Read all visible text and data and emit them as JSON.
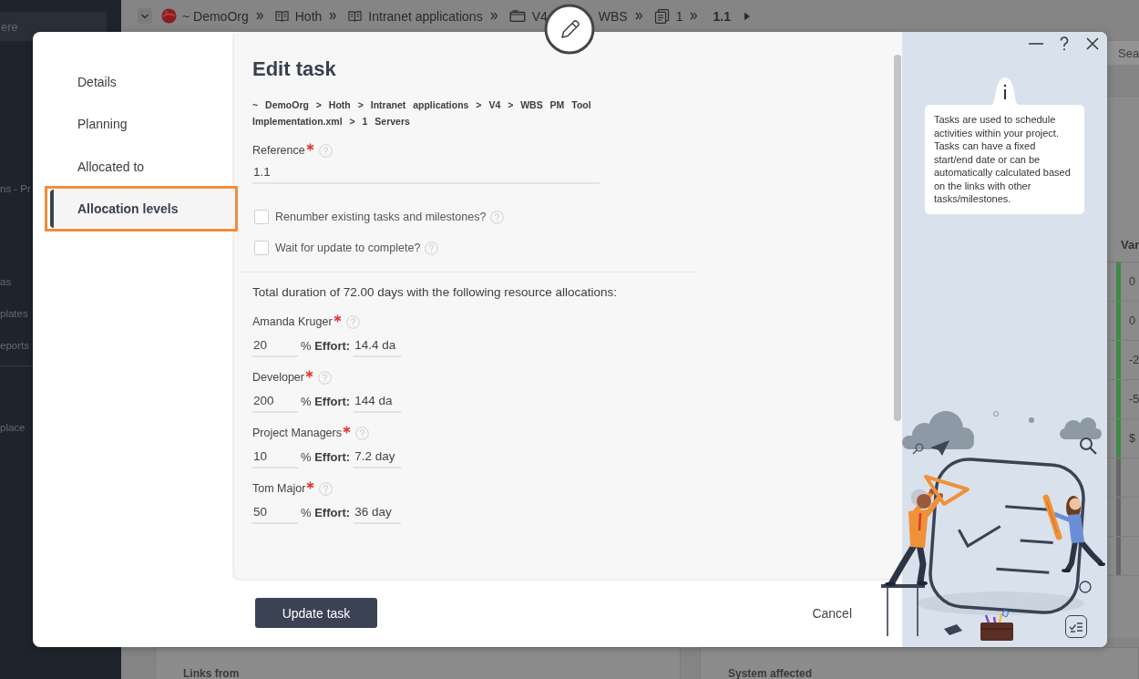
{
  "app": {
    "sidebar": {
      "search_placeholder": "ere",
      "sections": [
        {
          "items": [
            "ns - Pr"
          ]
        },
        {
          "items": [
            "as",
            "plates",
            "eports"
          ]
        },
        {
          "divider": true,
          "items": [
            "place"
          ]
        }
      ]
    },
    "breadcrumb": [
      {
        "label": "~ DemoOrg",
        "kind": "logo",
        "current": false
      },
      {
        "label": "Hoth",
        "kind": "book",
        "separator": true,
        "current": false
      },
      {
        "label": "Intranet applications",
        "kind": "book",
        "separator": true,
        "current": false
      },
      {
        "label": "V4",
        "kind": "folder",
        "separator": true,
        "current": false
      },
      {
        "label": "WBS",
        "kind": "plain",
        "separator": false,
        "current": false
      },
      {
        "label": "1",
        "kind": "document",
        "separator": true,
        "current": false
      },
      {
        "label": "1.1",
        "kind": "plain",
        "separator": true,
        "current": true
      }
    ],
    "search_placeholder": "Sea",
    "table": {
      "header": "Var",
      "cells": [
        {
          "text": "0",
          "color": "#3e8a45"
        },
        {
          "text": "0",
          "color": "#3e8a45"
        },
        {
          "text": "-2",
          "color": "#3e8a45"
        },
        {
          "text": "-5",
          "color": "#3e8a45"
        },
        {
          "text": "$",
          "color": "#3e8a45"
        },
        {
          "color": "#666666"
        },
        {
          "color": "#666666"
        },
        {
          "color": "#666666"
        }
      ]
    },
    "panels": [
      "Links from",
      "System affected"
    ]
  },
  "dialog": {
    "nav": [
      {
        "label": "Details",
        "selected": false,
        "highlighted": false
      },
      {
        "label": "Planning",
        "selected": false,
        "highlighted": false
      },
      {
        "label": "Allocated to",
        "selected": false,
        "highlighted": false
      },
      {
        "label": "Allocation levels",
        "selected": true,
        "highlighted": true
      }
    ],
    "title": "Edit task",
    "breadcrumb": "~ DemoOrg > Hoth > Intranet applications > V4 > WBS PM Tool Implementation.xml > 1 Servers",
    "reference": {
      "label": "Reference",
      "required": true,
      "value": "1.1"
    },
    "options": [
      {
        "label": "Renumber existing tasks and milestones?",
        "checked": false
      },
      {
        "label": "Wait for update to complete?",
        "checked": false
      }
    ],
    "summary": "Total duration of 72.00 days with the following resource allocations:",
    "allocations": [
      {
        "name": "Amanda Kruger",
        "required": true,
        "percent": "20",
        "unit": "% **Effort:**",
        "effort": "14.4 da"
      },
      {
        "name": "Developer",
        "required": true,
        "percent": "200",
        "unit": "% **Effort:**",
        "effort": "144 da"
      },
      {
        "name": "Project Managers",
        "required": true,
        "percent": "10",
        "unit": "% **Effort:**",
        "effort": "7.2 day"
      },
      {
        "name": "Tom Major",
        "required": true,
        "percent": "50",
        "unit": "% **Effort:**",
        "effort": "36 day"
      }
    ],
    "buttons": {
      "primary": "Update task",
      "cancel": "Cancel"
    },
    "help_text": "Tasks are used to schedule activities within your project. Tasks can have a fixed start/end date or can be automatically calculated based on the links with other tasks/milestones."
  }
}
